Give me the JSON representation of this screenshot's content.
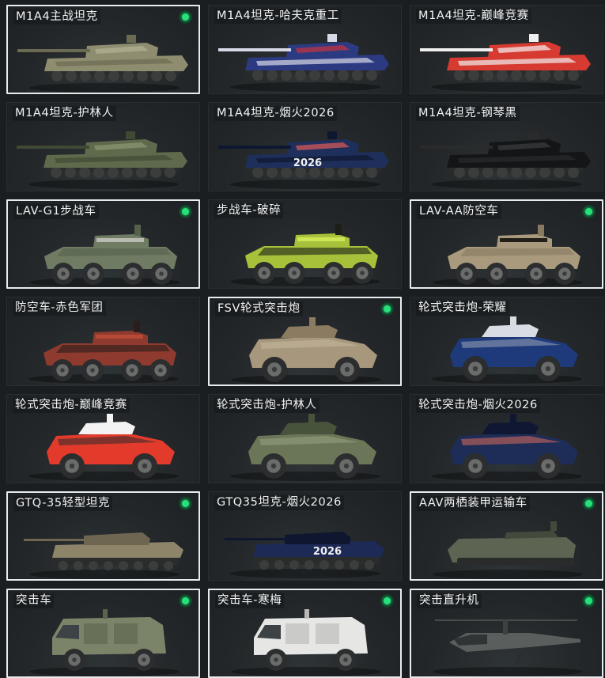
{
  "vehicles": [
    {
      "name": "M1A4主战坦克",
      "type": "tank",
      "owned": true,
      "colors": {
        "body": "#8f8d6f",
        "accent": "#6b6a52",
        "stripe": "#b4b295"
      }
    },
    {
      "name": "M1A4坦克-哈夫克重工",
      "type": "tank",
      "owned": false,
      "colors": {
        "body": "#2c3a82",
        "accent": "#d7dae6",
        "stripe": "#c8333a"
      }
    },
    {
      "name": "M1A4坦克-巅峰竞赛",
      "type": "tank",
      "owned": false,
      "colors": {
        "body": "#d63a30",
        "accent": "#efefef",
        "stripe": "#f4f4f4"
      }
    },
    {
      "name": "M1A4坦克-护林人",
      "type": "tank",
      "owned": false,
      "colors": {
        "body": "#5f6a4c",
        "accent": "#3f4a34",
        "stripe": "#8b9a75"
      }
    },
    {
      "name": "M1A4坦克-烟火2026",
      "type": "tank",
      "owned": false,
      "colors": {
        "body": "#1f2f5b",
        "accent": "#0e1730",
        "stripe": "#e05a5a"
      },
      "decal": "2026"
    },
    {
      "name": "M1A4坦克-钢琴黑",
      "type": "tank",
      "owned": false,
      "colors": {
        "body": "#141516",
        "accent": "#2a2b2d",
        "stripe": "#3c3d40"
      }
    },
    {
      "name": "LAV-G1步战车",
      "type": "apc",
      "owned": true,
      "colors": {
        "body": "#6f7c63",
        "accent": "#55614b",
        "stripe": "#c9cbc4"
      }
    },
    {
      "name": "步战车-破碎",
      "type": "apc",
      "owned": false,
      "colors": {
        "body": "#a7c23a",
        "accent": "#1c1f19",
        "stripe": "#d8ef5c"
      }
    },
    {
      "name": "LAV-AA防空车",
      "type": "apc",
      "owned": true,
      "colors": {
        "body": "#a99a7d",
        "accent": "#877a61",
        "stripe": "#cbbf a5"
      }
    },
    {
      "name": "防空车-赤色军团",
      "type": "apc",
      "owned": false,
      "colors": {
        "body": "#8e3a2e",
        "accent": "#2a1d1b",
        "stripe": "#c24d3a"
      }
    },
    {
      "name": "FSV轮式突击炮",
      "type": "fsv",
      "owned": true,
      "colors": {
        "body": "#a7977c",
        "accent": "#8a7b61",
        "stripe": "#c7b99c"
      }
    },
    {
      "name": "轮式突击炮-荣耀",
      "type": "fsv",
      "owned": false,
      "colors": {
        "body": "#1e3a7b",
        "accent": "#d9dce3",
        "stripe": "#9aa4b6"
      }
    },
    {
      "name": "轮式突击炮-巅峰竞赛",
      "type": "fsv",
      "owned": false,
      "colors": {
        "body": "#e23b2c",
        "accent": "#f3f3f3",
        "stripe": "#2b2b2b"
      }
    },
    {
      "name": "轮式突击炮-护林人",
      "type": "fsv",
      "owned": false,
      "colors": {
        "body": "#6a7657",
        "accent": "#48533c",
        "stripe": "#97a381"
      }
    },
    {
      "name": "轮式突击炮-烟火2026",
      "type": "fsv",
      "owned": false,
      "colors": {
        "body": "#1e2d58",
        "accent": "#0f1733",
        "stripe": "#d96b5b"
      }
    },
    {
      "name": "GTQ-35轻型坦克",
      "type": "light",
      "owned": true,
      "colors": {
        "body": "#8d8469",
        "accent": "#6e6651",
        "stripe": "#a89f83"
      }
    },
    {
      "name": "GTQ35坦克-烟火2026",
      "type": "light",
      "owned": false,
      "colors": {
        "body": "#1d2a55",
        "accent": "#0e1630",
        "stripe": "#d75a52"
      },
      "decal": "2026"
    },
    {
      "name": "AAV两栖装甲运输车",
      "type": "aav",
      "owned": true,
      "colors": {
        "body": "#5d6452",
        "accent": "#434a3b",
        "stripe": "#7c8470"
      }
    },
    {
      "name": "突击车",
      "type": "truck",
      "owned": true,
      "colors": {
        "body": "#7b8468",
        "accent": "#5b634c",
        "stripe": "#a5ad92"
      }
    },
    {
      "name": "突击车-寒梅",
      "type": "truck",
      "owned": true,
      "colors": {
        "body": "#e6e6e4",
        "accent": "#b8b8b5",
        "stripe": "#b3343a"
      }
    },
    {
      "name": "突击直升机",
      "type": "heli",
      "owned": true,
      "colors": {
        "body": "#5a5e5c",
        "accent": "#3d4140",
        "stripe": "#7a7f7c"
      }
    }
  ]
}
